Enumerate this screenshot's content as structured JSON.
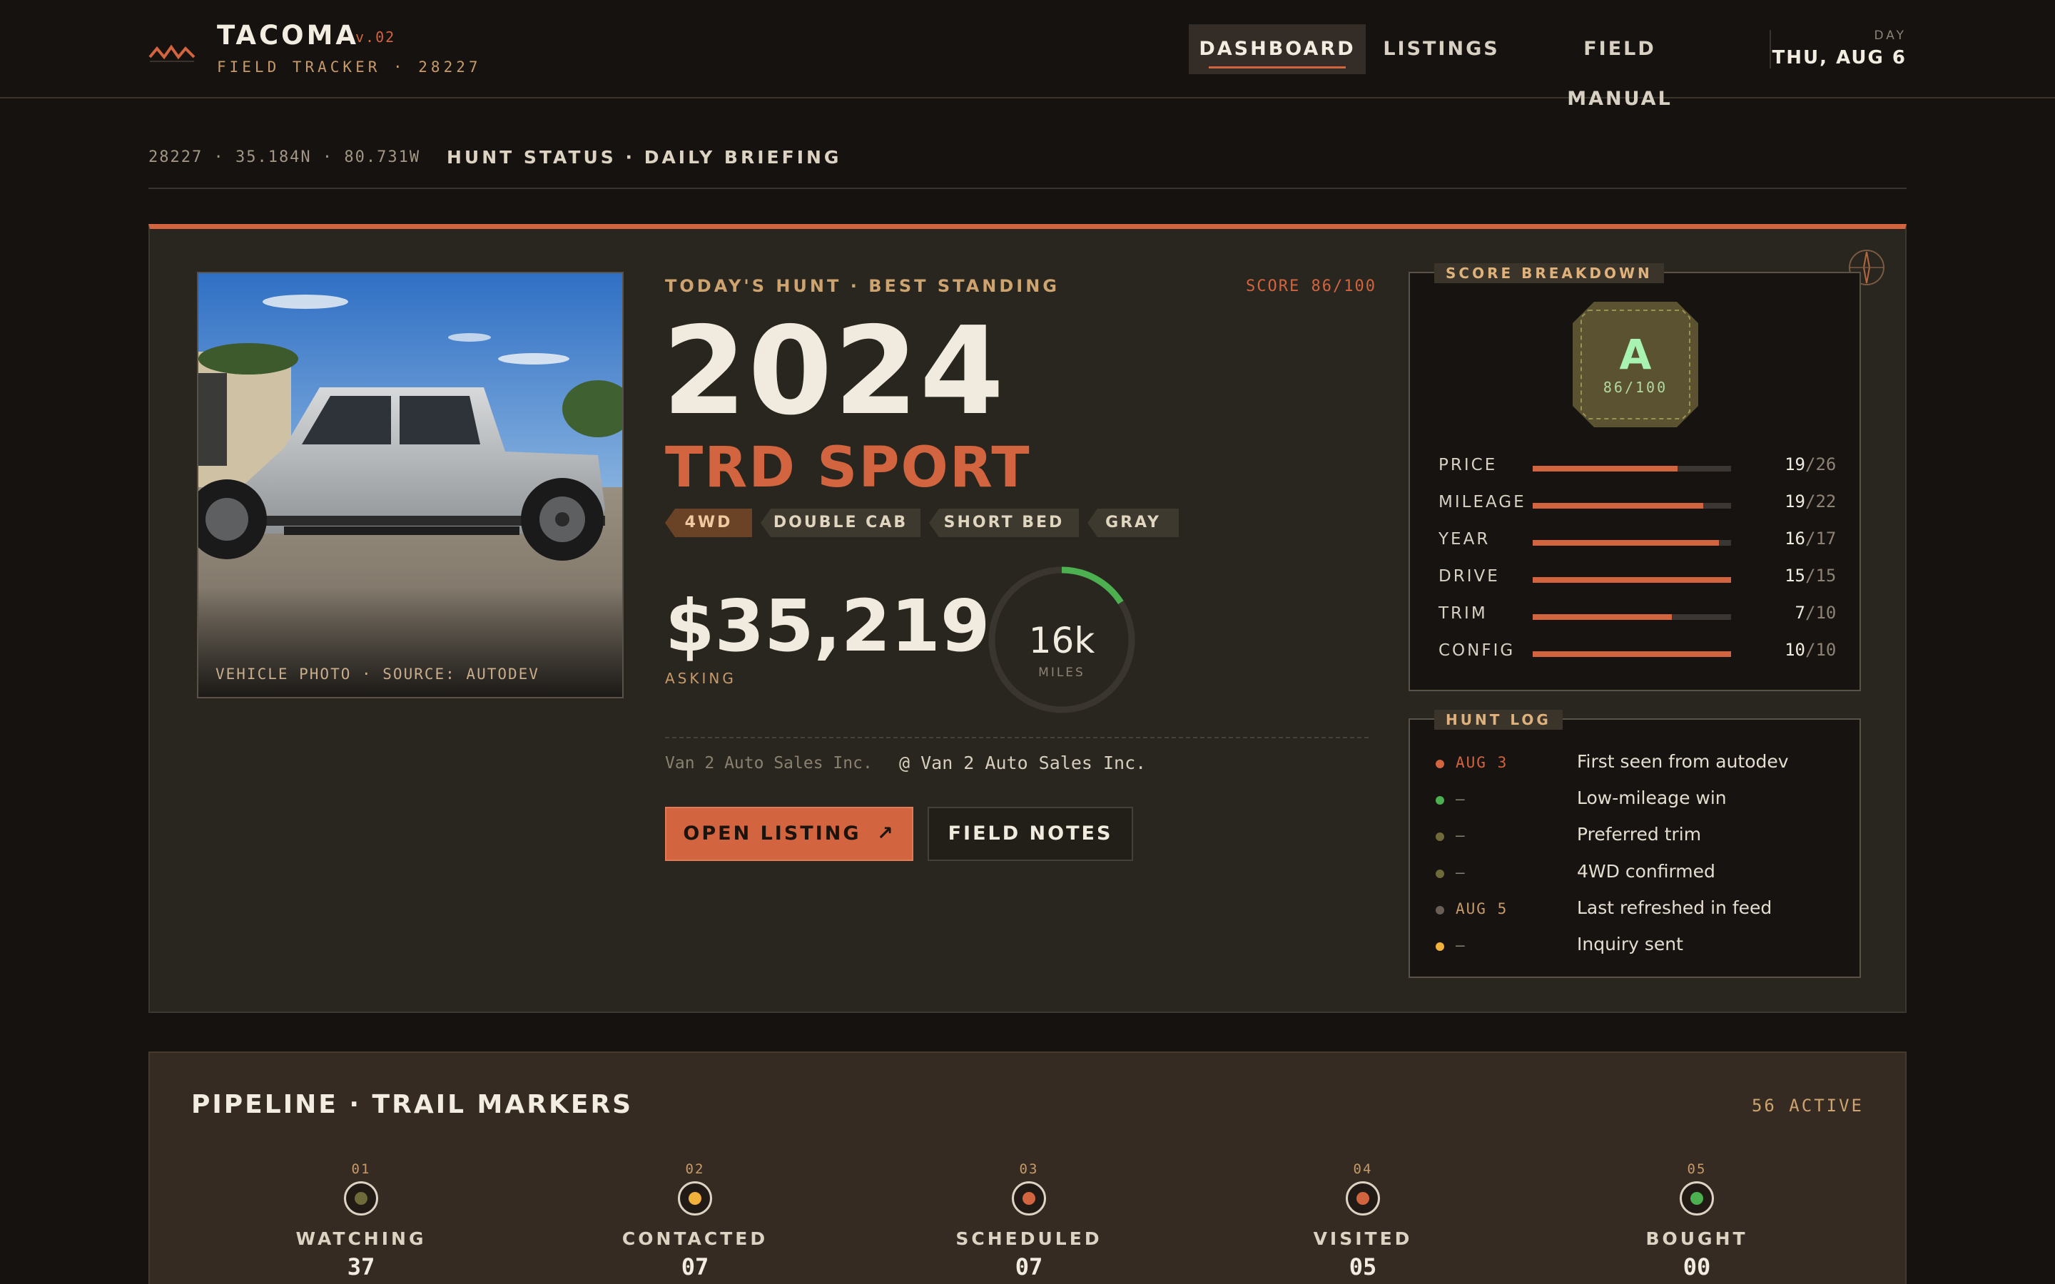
{
  "brand": {
    "title": "TACOMA",
    "version": "v.02",
    "subtitle": "FIELD TRACKER · 28227"
  },
  "nav": {
    "tabs": [
      {
        "label": "DASHBOARD",
        "active": true
      },
      {
        "label": "LISTINGS",
        "active": false
      },
      {
        "label": "FIELD MANUAL",
        "active": false
      }
    ]
  },
  "day": {
    "label": "DAY",
    "value": "THU, AUG 6"
  },
  "status": {
    "coords": "28227 · 35.184N · 80.731W",
    "title": "HUNT STATUS · DAILY BRIEFING"
  },
  "colors": {
    "accent": "#d2643f",
    "green": "#4caf50",
    "olive": "#6e6a3a",
    "amber": "#f2b13a"
  },
  "hunt": {
    "kicker": "TODAY'S HUNT · BEST STANDING",
    "score": "SCORE 86/100",
    "year": "2024",
    "trim": "TRD SPORT",
    "tags": [
      "4WD",
      "DOUBLE CAB",
      "SHORT BED",
      "GRAY"
    ],
    "price": "$35,219",
    "price_label": "ASKING",
    "miles": "16k",
    "miles_label": "MILES",
    "miles_gauge_fraction": 0.16,
    "dealer_name": "Van 2 Auto Sales Inc.",
    "dealer_at": "@ Van 2 Auto Sales Inc.",
    "photo_caption": "VEHICLE PHOTO · SOURCE: AUTODEV",
    "open_button": "OPEN LISTING",
    "open_icon": "↗",
    "notes_button": "FIELD NOTES"
  },
  "score_breakdown": {
    "title": "SCORE BREAKDOWN",
    "grade": "A",
    "grade_score": "86/100",
    "rows": [
      {
        "label": "PRICE",
        "value": "19",
        "max": "/26",
        "fraction": 0.73
      },
      {
        "label": "MILEAGE",
        "value": "19",
        "max": "/22",
        "fraction": 0.86
      },
      {
        "label": "YEAR",
        "value": "16",
        "max": "/17",
        "fraction": 0.94
      },
      {
        "label": "DRIVE",
        "value": "15",
        "max": "/15",
        "fraction": 1.0
      },
      {
        "label": "TRIM",
        "value": "7",
        "max": "/10",
        "fraction": 0.7
      },
      {
        "label": "CONFIG",
        "value": "10",
        "max": "/10",
        "fraction": 1.0
      }
    ]
  },
  "hunt_log": {
    "title": "HUNT LOG",
    "entries": [
      {
        "date": "AUG 3",
        "text": "First seen from autodev",
        "dot": "#d2643f",
        "date_color": "#d2643f"
      },
      {
        "date": "—",
        "text": "Low-mileage win",
        "dot": "#4caf50",
        "date_color": "#8d8274"
      },
      {
        "date": "—",
        "text": "Preferred trim",
        "dot": "#6e6a3a",
        "date_color": "#8d8274"
      },
      {
        "date": "—",
        "text": "4WD confirmed",
        "dot": "#6e6a3a",
        "date_color": "#8d8274"
      },
      {
        "date": "AUG 5",
        "text": "Last refreshed in feed",
        "dot": "#6a5f55",
        "date_color": "#c79a6a"
      },
      {
        "date": "—",
        "text": "Inquiry sent",
        "dot": "#f2b13a",
        "date_color": "#8d8274"
      }
    ]
  },
  "pipeline": {
    "title": "PIPELINE · TRAIL MARKERS",
    "active": "56 ACTIVE",
    "stages": [
      {
        "num": "01",
        "label": "WATCHING",
        "count": "37",
        "dot": "#6e6a3a"
      },
      {
        "num": "02",
        "label": "CONTACTED",
        "count": "07",
        "dot": "#f2b13a"
      },
      {
        "num": "03",
        "label": "SCHEDULED",
        "count": "07",
        "dot": "#d2643f"
      },
      {
        "num": "04",
        "label": "VISITED",
        "count": "05",
        "dot": "#d2643f"
      },
      {
        "num": "05",
        "label": "BOUGHT",
        "count": "00",
        "dot": "#4caf50"
      }
    ]
  }
}
